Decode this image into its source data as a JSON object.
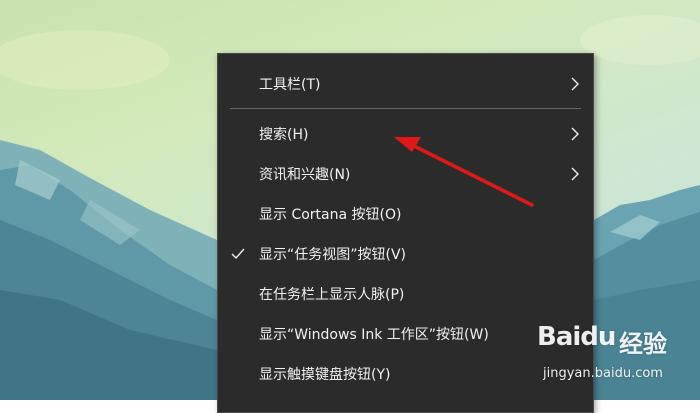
{
  "context_menu": {
    "items": [
      {
        "label": "工具栏(T)",
        "submenu": true,
        "checked": false
      },
      {
        "label": "搜索(H)",
        "submenu": true,
        "checked": false
      },
      {
        "label": "资讯和兴趣(N)",
        "submenu": true,
        "checked": false
      },
      {
        "label": "显示 Cortana 按钮(O)",
        "submenu": false,
        "checked": false
      },
      {
        "label": "显示“任务视图”按钮(V)",
        "submenu": false,
        "checked": true
      },
      {
        "label": "在任务栏上显示人脉(P)",
        "submenu": false,
        "checked": false
      },
      {
        "label": "显示“Windows Ink 工作区”按钮(W)",
        "submenu": false,
        "checked": false
      },
      {
        "label": "显示触摸键盘按钮(Y)",
        "submenu": false,
        "checked": false
      }
    ]
  },
  "watermark": {
    "brand": "Baidu",
    "brand_cn": "经验",
    "site": "jingyan.baidu.com"
  },
  "colors": {
    "menu_bg": "#2b2b2b",
    "menu_text": "#f2f2f2",
    "arrow": "#e01818"
  },
  "icons": {
    "chevron": "chevron-right-icon",
    "check": "checkmark-icon"
  }
}
